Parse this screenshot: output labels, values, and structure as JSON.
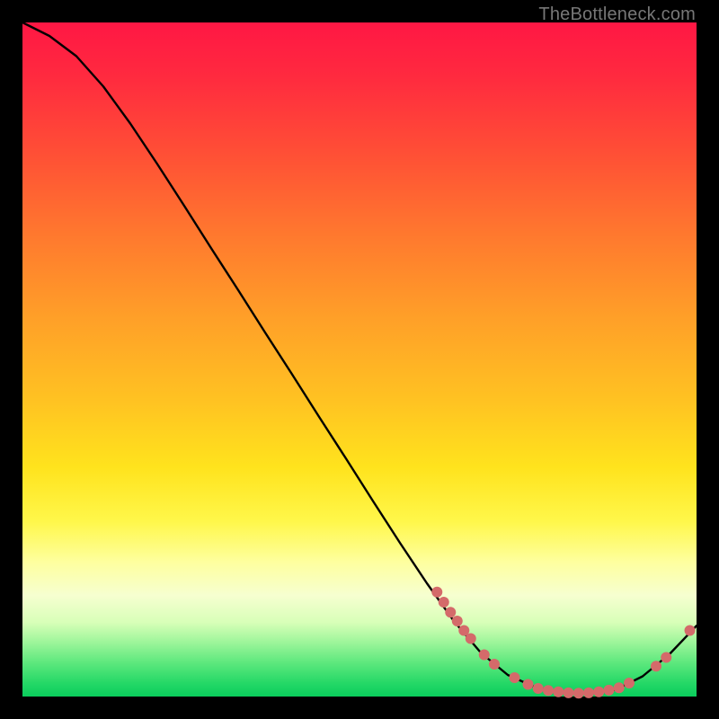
{
  "attribution": "TheBottleneck.com",
  "chart_data": {
    "type": "line",
    "title": "",
    "xlabel": "",
    "ylabel": "",
    "xlim": [
      0,
      100
    ],
    "ylim": [
      0,
      100
    ],
    "grid": false,
    "series": [
      {
        "name": "bottleneck-curve",
        "x": [
          0,
          4,
          8,
          12,
          16,
          20,
          24,
          28,
          32,
          36,
          40,
          44,
          48,
          52,
          56,
          60,
          64,
          68,
          72,
          76,
          80,
          84,
          88,
          92,
          96,
          100
        ],
        "y": [
          100,
          98,
          95,
          90.5,
          85,
          79,
          72.8,
          66.5,
          60.3,
          54,
          47.8,
          41.5,
          35.3,
          29,
          22.8,
          16.8,
          11.2,
          6.5,
          3.2,
          1.4,
          0.6,
          0.5,
          1.0,
          3.0,
          6.3,
          10.5
        ],
        "color": "#000000"
      }
    ],
    "marker_clusters": [
      {
        "name": "cluster-left-slope",
        "color": "#d46a6a",
        "points": [
          {
            "x": 61.5,
            "y": 15.5
          },
          {
            "x": 62.5,
            "y": 14.0
          },
          {
            "x": 63.5,
            "y": 12.5
          },
          {
            "x": 64.5,
            "y": 11.2
          },
          {
            "x": 65.5,
            "y": 9.8
          },
          {
            "x": 66.5,
            "y": 8.6
          }
        ]
      },
      {
        "name": "cluster-sparse",
        "color": "#d46a6a",
        "points": [
          {
            "x": 68.5,
            "y": 6.2
          },
          {
            "x": 70.0,
            "y": 4.8
          }
        ]
      },
      {
        "name": "cluster-valley",
        "color": "#d46a6a",
        "points": [
          {
            "x": 73.0,
            "y": 2.8
          },
          {
            "x": 75.0,
            "y": 1.8
          },
          {
            "x": 76.5,
            "y": 1.2
          },
          {
            "x": 78.0,
            "y": 0.9
          },
          {
            "x": 79.5,
            "y": 0.7
          },
          {
            "x": 81.0,
            "y": 0.55
          },
          {
            "x": 82.5,
            "y": 0.5
          },
          {
            "x": 84.0,
            "y": 0.55
          },
          {
            "x": 85.5,
            "y": 0.7
          },
          {
            "x": 87.0,
            "y": 0.95
          },
          {
            "x": 88.5,
            "y": 1.3
          },
          {
            "x": 90.0,
            "y": 2.0
          }
        ]
      },
      {
        "name": "cluster-right-slope",
        "color": "#d46a6a",
        "points": [
          {
            "x": 94.0,
            "y": 4.5
          },
          {
            "x": 95.5,
            "y": 5.8
          }
        ]
      },
      {
        "name": "cluster-endpoint",
        "color": "#d46a6a",
        "points": [
          {
            "x": 99.0,
            "y": 9.8
          }
        ]
      }
    ]
  }
}
